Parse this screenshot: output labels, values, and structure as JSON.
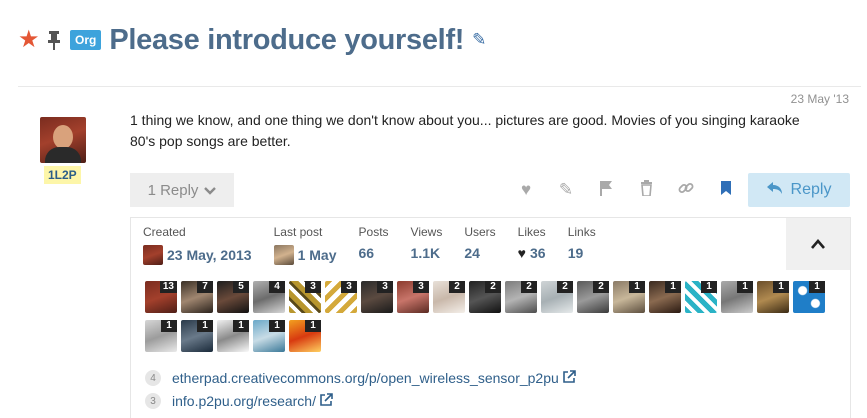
{
  "topic": {
    "title": "Please introduce yourself!",
    "category_tag": "Org",
    "icons": {
      "star": "star-icon",
      "pin": "pin-icon",
      "edit": "pencil-icon"
    }
  },
  "post": {
    "date": "23 May '13",
    "username": "1L2P",
    "body": "1 thing we know, and one thing we don't know about you... pictures are good. Movies of you singing karaoke 80's pop songs are better."
  },
  "controls": {
    "replies_label": "1 Reply",
    "reply_button": "Reply",
    "action_icons": [
      "heart-icon",
      "pencil-icon",
      "flag-icon",
      "trash-icon",
      "link-icon",
      "bookmark-icon"
    ]
  },
  "topic_map": {
    "created_label": "Created",
    "created_value": "23 May, 2013",
    "last_post_label": "Last post",
    "last_post_value": "1 May",
    "posts_label": "Posts",
    "posts_value": "66",
    "views_label": "Views",
    "views_value": "1.1K",
    "users_label": "Users",
    "users_value": "24",
    "likes_label": "Likes",
    "likes_value": "36",
    "links_label": "Links",
    "links_value": "19",
    "participant_counts": [
      "13",
      "7",
      "5",
      "4",
      "3",
      "3",
      "3",
      "3",
      "2",
      "2",
      "2",
      "2",
      "2",
      "1",
      "1",
      "1",
      "1",
      "1",
      "1",
      "1",
      "1",
      "1",
      "1",
      "1"
    ],
    "links": [
      {
        "count": "4",
        "text": "etherpad.creativecommons.org/p/open_wireless_sensor_p2pu"
      },
      {
        "count": "3",
        "text": "info.p2pu.org/research/"
      }
    ]
  },
  "colors": {
    "title": "#4d6c8b",
    "star": "#e45735",
    "tag": "#3da3dc",
    "reply_button_bg": "#d1e8f5",
    "bookmark": "#2f6fb7"
  }
}
